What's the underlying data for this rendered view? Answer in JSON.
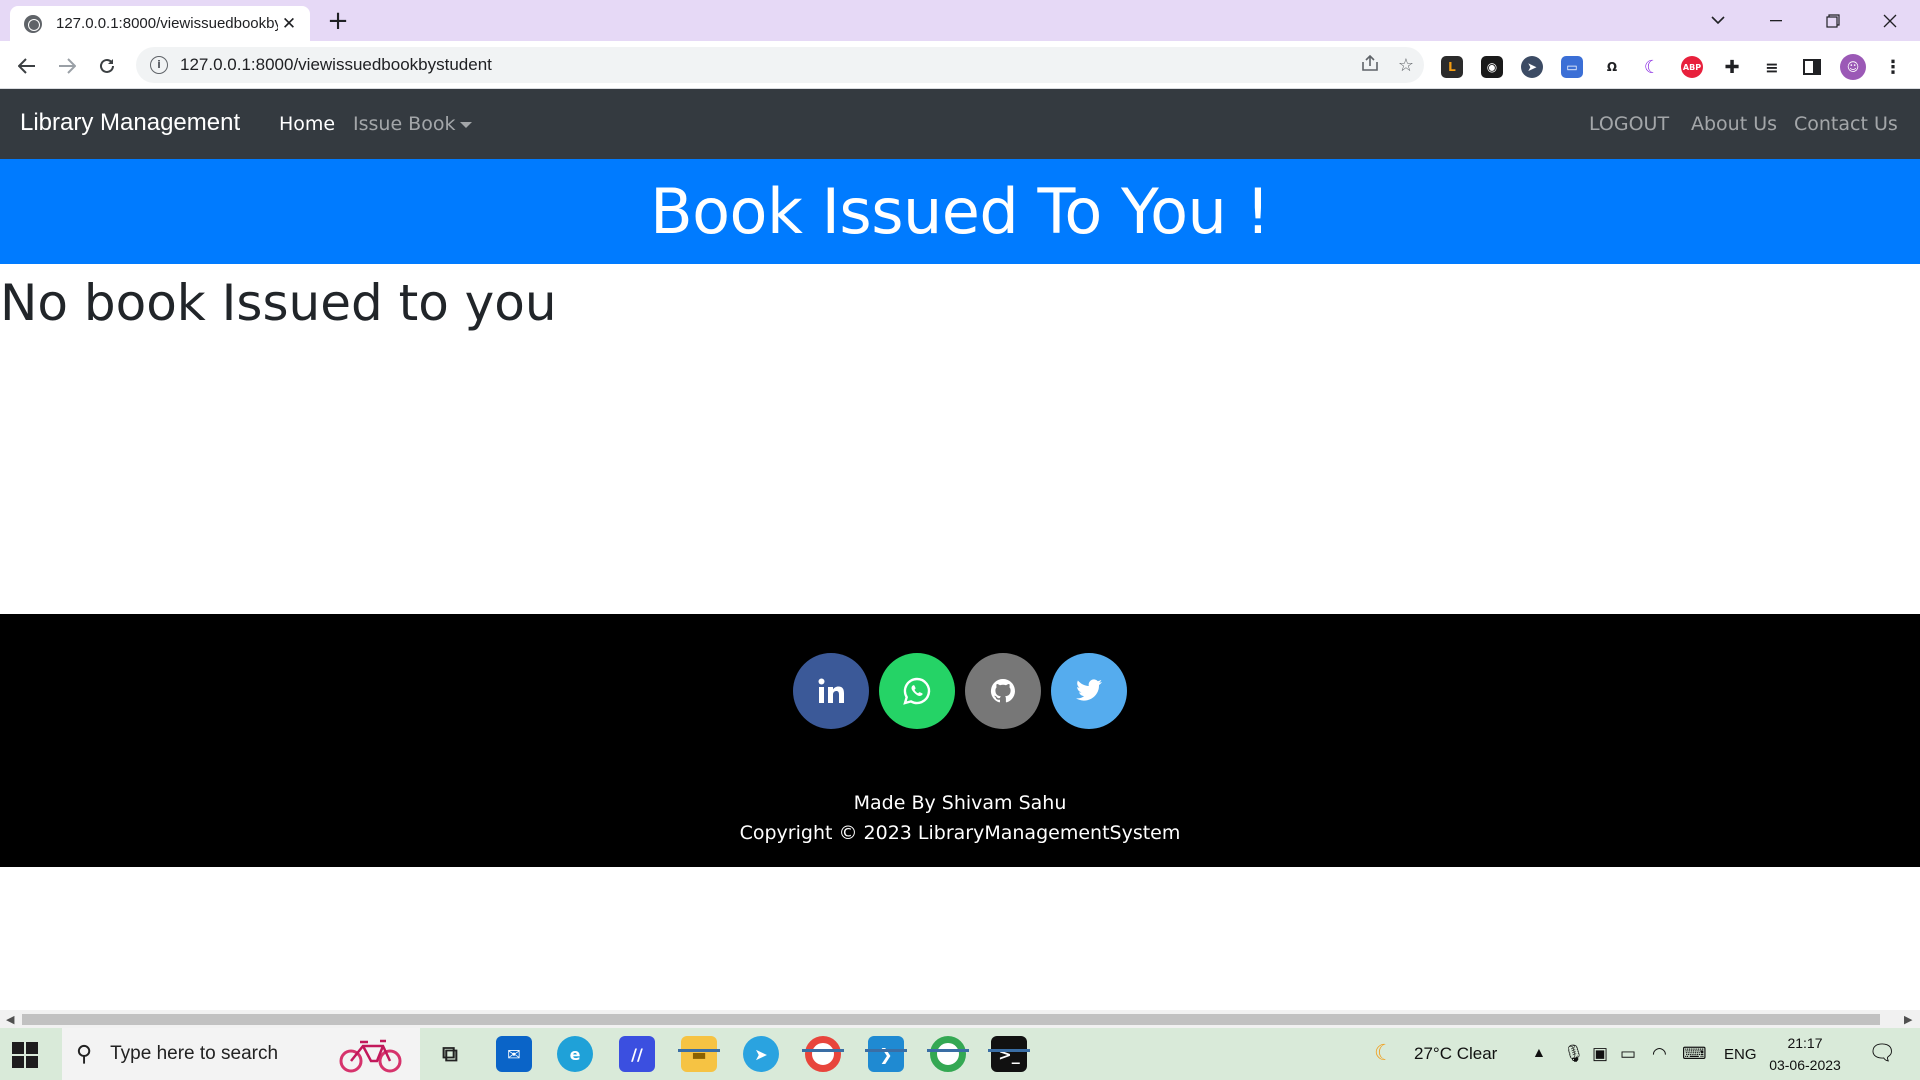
{
  "browser": {
    "tab_title": "127.0.0.1:8000/viewissuedbookby",
    "url": "127.0.0.1:8000/viewissuedbookbystudent",
    "new_tab_symbol": "+",
    "close_symbol": "✕"
  },
  "navbar": {
    "brand": "Library Management",
    "links": {
      "home": "Home",
      "issue_book": "Issue Book",
      "logout": "LOGOUT",
      "about": "About Us",
      "contact": "Contact Us"
    }
  },
  "hero": {
    "title": "Book Issued To You !"
  },
  "main": {
    "message": "No book Issued to you"
  },
  "footer": {
    "social": [
      {
        "name": "linkedin",
        "color": "#3b5998"
      },
      {
        "name": "whatsapp",
        "color": "#25d366"
      },
      {
        "name": "github",
        "color": "#777777"
      },
      {
        "name": "twitter",
        "color": "#55acee"
      }
    ],
    "made_by": "Made By Shivam Sahu",
    "copyright": "Copyright © 2023 LibraryManagementSystem"
  },
  "taskbar": {
    "search_placeholder": "Type here to search",
    "weather": "27°C  Clear",
    "language": "ENG",
    "time": "21:17",
    "date": "03-06-2023"
  },
  "colors": {
    "navbar_bg": "#343a40",
    "hero_bg": "#007bff",
    "footer_bg": "#000000",
    "tabstrip_bg": "#e6d9f6"
  }
}
